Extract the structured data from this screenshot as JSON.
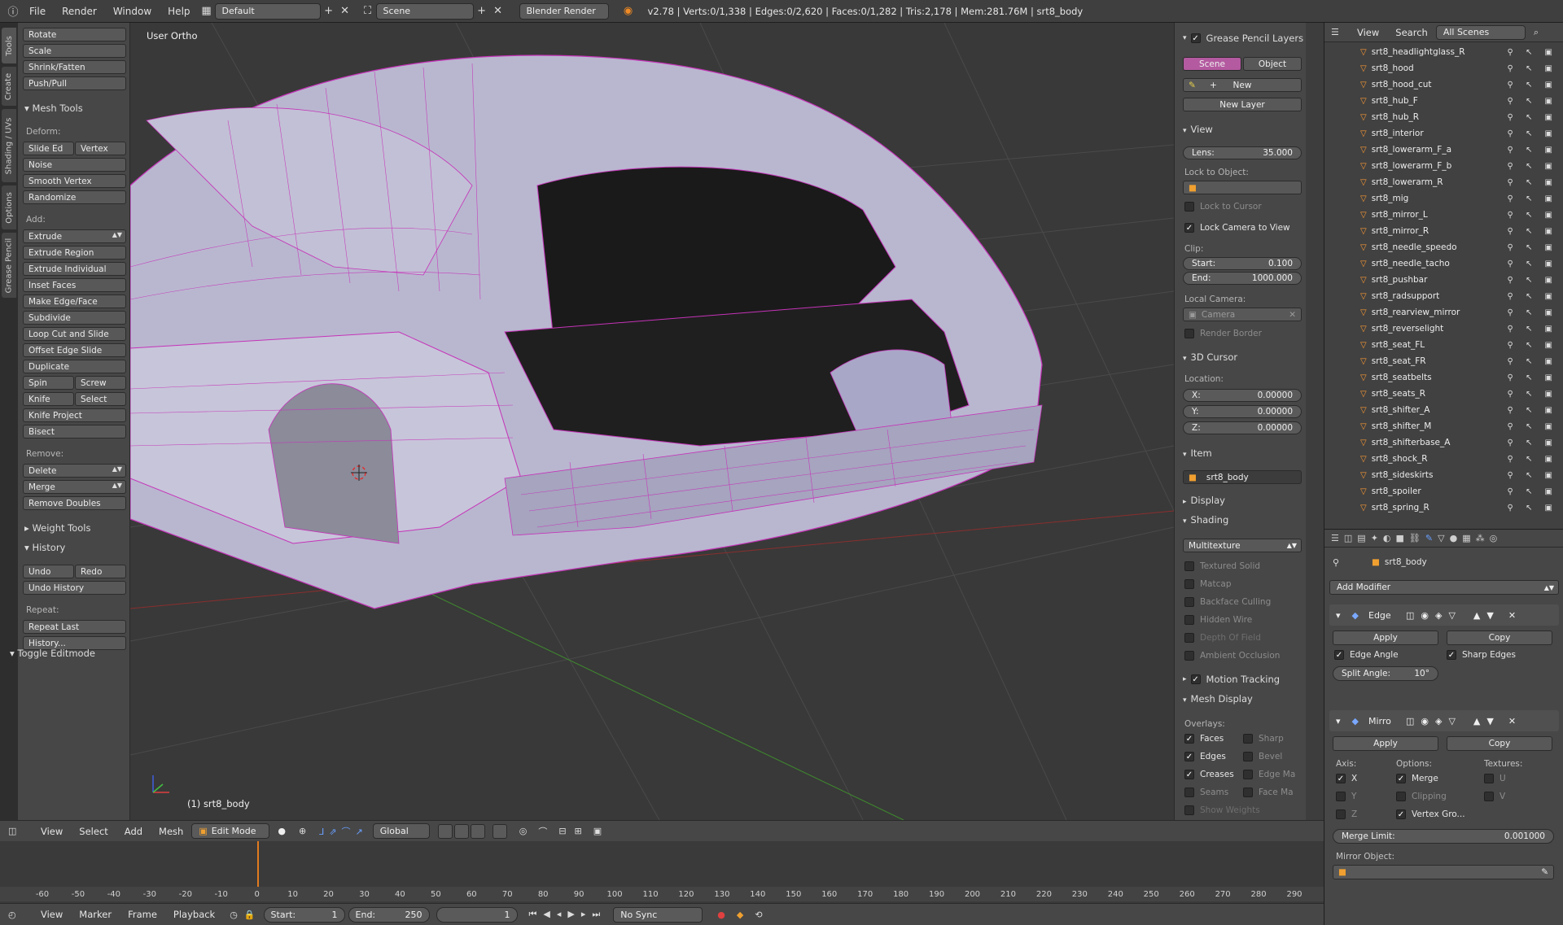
{
  "topbar": {
    "menus": [
      "File",
      "Render",
      "Window",
      "Help"
    ],
    "layout": "Default",
    "scene": "Scene",
    "engine": "Blender Render",
    "stats": "v2.78 | Verts:0/1,338 | Edges:0/2,620 | Faces:0/1,282 | Tris:2,178 | Mem:281.76M | srt8_body"
  },
  "tabs": [
    "Tools",
    "Create",
    "Shading / UVs",
    "Options",
    "Grease Pencil"
  ],
  "toolshelf": {
    "transform_buttons": [
      "Rotate",
      "Scale",
      "Shrink/Fatten",
      "Push/Pull"
    ],
    "mesh_tools_header": "Mesh Tools",
    "deform_label": "Deform:",
    "slide_edge": "Slide Ed",
    "vertex": "Vertex",
    "noise": "Noise",
    "smooth_vertex": "Smooth Vertex",
    "randomize": "Randomize",
    "add_label": "Add:",
    "extrude": "Extrude",
    "add_buttons": [
      "Extrude Region",
      "Extrude Individual",
      "Inset Faces",
      "Make Edge/Face",
      "Subdivide",
      "Loop Cut and Slide",
      "Offset Edge Slide",
      "Duplicate"
    ],
    "spin": "Spin",
    "screw": "Screw",
    "knife": "Knife",
    "select": "Select",
    "knife_project": "Knife Project",
    "bisect": "Bisect",
    "remove_label": "Remove:",
    "delete": "Delete",
    "merge": "Merge",
    "remove_doubles": "Remove Doubles",
    "weight_tools_header": "Weight Tools",
    "history_header": "History",
    "undo": "Undo",
    "redo": "Redo",
    "undo_history": "Undo History",
    "repeat_label": "Repeat:",
    "repeat_last": "Repeat Last",
    "history_btn": "History...",
    "toggle_editmode": "Toggle Editmode"
  },
  "viewport": {
    "view_label": "User Ortho",
    "object_label": "(1) srt8_body"
  },
  "npanel": {
    "gp_header": "Grease Pencil Layers",
    "scene_tab": "Scene",
    "object_tab": "Object",
    "new": "New",
    "new_layer": "New Layer",
    "view_header": "View",
    "lens_label": "Lens:",
    "lens_value": "35.000",
    "lock_to_object": "Lock to Object:",
    "lock_to_cursor": "Lock to Cursor",
    "lock_camera": "Lock Camera to View",
    "clip_label": "Clip:",
    "clip_start_label": "Start:",
    "clip_start": "0.100",
    "clip_end_label": "End:",
    "clip_end": "1000.000",
    "local_camera": "Local Camera:",
    "camera": "Camera",
    "render_border": "Render Border",
    "cursor_header": "3D Cursor",
    "location_label": "Location:",
    "x_label": "X:",
    "y_label": "Y:",
    "z_label": "Z:",
    "x": "0.00000",
    "y": "0.00000",
    "z": "0.00000",
    "item_header": "Item",
    "item_name": "srt8_body",
    "display_header": "Display",
    "shading_header": "Shading",
    "shading_mode": "Multitexture",
    "shading_opts": [
      "Textured Solid",
      "Matcap",
      "Backface Culling",
      "Hidden Wire",
      "Depth Of Field",
      "Ambient Occlusion"
    ],
    "motion_tracking": "Motion Tracking",
    "mesh_display_header": "Mesh Display",
    "overlays_label": "Overlays:",
    "overlays_left": [
      "Faces",
      "Edges",
      "Creases",
      "Seams"
    ],
    "overlays_right": [
      "Sharp",
      "Bevel",
      "Edge Ma",
      "Face Ma"
    ],
    "show_weights": "Show Weights"
  },
  "outliner": {
    "view": "View",
    "search": "Search",
    "scenes": "All Scenes",
    "items": [
      "srt8_headlightglass_R",
      "srt8_hood",
      "srt8_hood_cut",
      "srt8_hub_F",
      "srt8_hub_R",
      "srt8_interior",
      "srt8_lowerarm_F_a",
      "srt8_lowerarm_F_b",
      "srt8_lowerarm_R",
      "srt8_mig",
      "srt8_mirror_L",
      "srt8_mirror_R",
      "srt8_needle_speedo",
      "srt8_needle_tacho",
      "srt8_pushbar",
      "srt8_radsupport",
      "srt8_rearview_mirror",
      "srt8_reverselight",
      "srt8_seat_FL",
      "srt8_seat_FR",
      "srt8_seatbelts",
      "srt8_seats_R",
      "srt8_shifter_A",
      "srt8_shifter_M",
      "srt8_shifterbase_A",
      "srt8_shock_R",
      "srt8_sideskirts",
      "srt8_spoiler",
      "srt8_spring_R"
    ]
  },
  "props": {
    "object": "srt8_body",
    "add_modifier": "Add Modifier",
    "edge_mod": "Edge",
    "apply": "Apply",
    "copy": "Copy",
    "edge_angle": "Edge Angle",
    "sharp_edges": "Sharp Edges",
    "split_angle_label": "Split Angle:",
    "split_angle": "10°",
    "mirror_mod": "Mirro",
    "axis_label": "Axis:",
    "options_label": "Options:",
    "textures_label": "Textures:",
    "axis_x": "X",
    "axis_y": "Y",
    "axis_z": "Z",
    "merge": "Merge",
    "clipping": "Clipping",
    "vertex_groups": "Vertex Gro...",
    "tex_u": "U",
    "tex_v": "V",
    "merge_limit_label": "Merge Limit:",
    "merge_limit": "0.001000",
    "mirror_object": "Mirror Object:"
  },
  "vpheader": {
    "menus": [
      "View",
      "Select",
      "Add",
      "Mesh"
    ],
    "mode": "Edit Mode",
    "orientation": "Global"
  },
  "timeline": {
    "ticks": [
      -60,
      -50,
      -40,
      -30,
      -20,
      -10,
      0,
      10,
      20,
      30,
      40,
      50,
      60,
      70,
      80,
      90,
      100,
      110,
      120,
      130,
      140,
      150,
      160,
      170,
      180,
      190,
      200,
      210,
      220,
      230,
      240,
      250,
      260,
      270,
      280,
      290
    ],
    "menus": [
      "View",
      "Marker",
      "Frame",
      "Playback"
    ],
    "start_label": "Start:",
    "start": "1",
    "end_label": "End:",
    "end": "250",
    "current": "1",
    "sync": "No Sync"
  },
  "colors": {
    "wire": "#c533b8",
    "mesh": "#b8b6cf",
    "accent": "#e07b1f",
    "tab_active": "#b45aa0"
  }
}
